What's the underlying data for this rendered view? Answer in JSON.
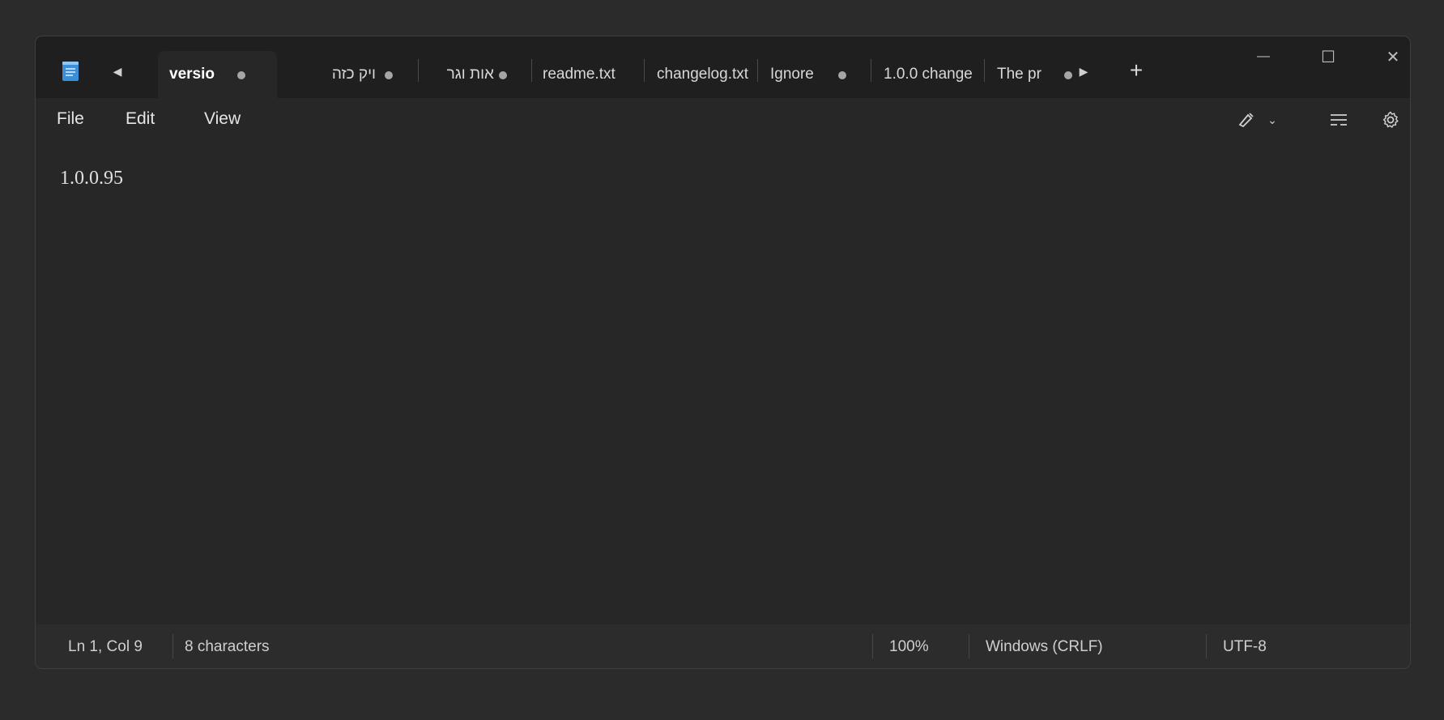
{
  "titlebar": {
    "tabs": [
      {
        "label": "versio",
        "active": true,
        "modified": true
      },
      {
        "label": "ויק כזה",
        "active": false,
        "modified": true
      },
      {
        "label": "אות וגר",
        "active": false,
        "modified": true
      },
      {
        "label": "readme.txt",
        "active": false,
        "modified": false
      },
      {
        "label": "changelog.txt",
        "active": false,
        "modified": false
      },
      {
        "label": "Ignore",
        "active": false,
        "modified": true
      },
      {
        "label": "1.0.0 change",
        "active": false,
        "modified": false
      },
      {
        "label": "The pr",
        "active": false,
        "modified": true
      }
    ],
    "new_tab_glyph": "+",
    "minimize_glyph": "—",
    "maximize_glyph": "☐",
    "close_glyph": "✕"
  },
  "menu": {
    "file": "File",
    "edit": "Edit",
    "view": "View"
  },
  "editor": {
    "content": "1.0.0.95"
  },
  "status": {
    "position": "Ln 1, Col 9",
    "chars": "8 characters",
    "zoom": "100%",
    "line_ending": "Windows (CRLF)",
    "encoding": "UTF-8"
  },
  "colors": {
    "accent": "#5aa9e6",
    "background": "#272727",
    "titlebar": "#1f1f1f"
  },
  "icons": {
    "app": "notepad-icon",
    "copilot": "copilot-icon",
    "format": "format-icon",
    "settings": "gear-icon"
  }
}
